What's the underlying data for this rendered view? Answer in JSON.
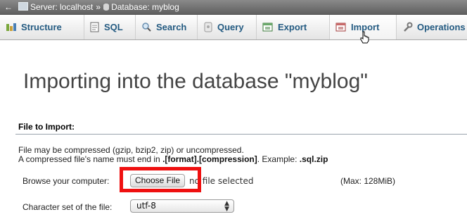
{
  "breadcrumb": {
    "back": "←",
    "server": "Server: localhost",
    "separator": "»",
    "database": "Database: myblog"
  },
  "tabs": [
    {
      "label": "Structure",
      "icon": "structure-icon"
    },
    {
      "label": "SQL",
      "icon": "sql-icon"
    },
    {
      "label": "Search",
      "icon": "search-icon"
    },
    {
      "label": "Query",
      "icon": "query-icon"
    },
    {
      "label": "Export",
      "icon": "export-icon"
    },
    {
      "label": "Import",
      "icon": "import-icon",
      "active": true
    },
    {
      "label": "Operations",
      "icon": "wrench-icon"
    }
  ],
  "page": {
    "title": "Importing into the database \"myblog\""
  },
  "file_import": {
    "legend": "File to Import:",
    "note_line1": "File may be compressed (gzip, bzip2, zip) or uncompressed.",
    "note_line2_prefix": "A compressed file's name must end in ",
    "note_line2_format": ".[format].[compression]",
    "note_line2_mid": ". Example: ",
    "note_line2_example": ".sql.zip",
    "browse_label": "Browse your computer:",
    "choose_button": "Choose File",
    "no_file": "no file selected",
    "max_size": "(Max: 128MiB)",
    "charset_label": "Character set of the file:",
    "charset_value": "utf-8"
  },
  "colors": {
    "tab_text": "#235a81",
    "highlight": "#ef1010"
  }
}
